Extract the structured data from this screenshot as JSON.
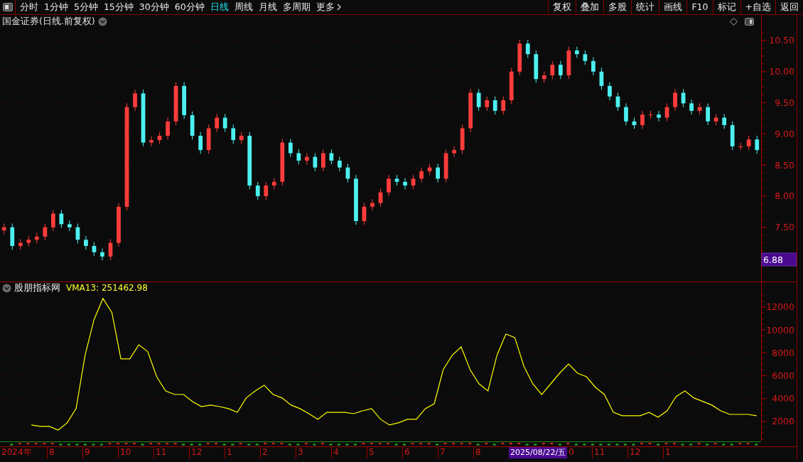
{
  "toolbar": {
    "periods": [
      {
        "label": "分时",
        "selected": false
      },
      {
        "label": "1分钟",
        "selected": false
      },
      {
        "label": "5分钟",
        "selected": false
      },
      {
        "label": "15分钟",
        "selected": false
      },
      {
        "label": "30分钟",
        "selected": false
      },
      {
        "label": "60分钟",
        "selected": false
      },
      {
        "label": "日线",
        "selected": true
      },
      {
        "label": "周线",
        "selected": false
      },
      {
        "label": "月线",
        "selected": false
      },
      {
        "label": "多周期",
        "selected": false
      },
      {
        "label": "更多",
        "selected": false
      }
    ],
    "actions": [
      "复权",
      "叠加",
      "多股",
      "统计",
      "画线",
      "F10",
      "标记",
      "+自选",
      "返回"
    ]
  },
  "price_panel": {
    "title": "国金证券(日线.前复权)",
    "chart_data": {
      "type": "candlestick",
      "ylim": [
        6.63,
        10.91
      ],
      "grid": true,
      "yticks": [
        {
          "value": 7.5,
          "label": "7.50"
        },
        {
          "value": 8,
          "label": "8.00"
        },
        {
          "value": 8.5,
          "label": "8.50"
        },
        {
          "value": 9,
          "label": "9.00"
        },
        {
          "value": 9.5,
          "label": "9.50"
        },
        {
          "value": 10,
          "label": "10.00"
        },
        {
          "value": 10.5,
          "label": "10.50"
        }
      ],
      "ohlc": [
        [
          7.45,
          7.56,
          7.39,
          7.5
        ],
        [
          7.5,
          7.56,
          7.14,
          7.2
        ],
        [
          7.2,
          7.31,
          7.14,
          7.25
        ],
        [
          7.25,
          7.36,
          7.19,
          7.3
        ],
        [
          7.3,
          7.41,
          7.24,
          7.35
        ],
        [
          7.35,
          7.56,
          7.29,
          7.5
        ],
        [
          7.5,
          7.78,
          7.44,
          7.72
        ],
        [
          7.72,
          7.78,
          7.49,
          7.55
        ],
        [
          7.55,
          7.61,
          7.44,
          7.5
        ],
        [
          7.5,
          7.56,
          7.24,
          7.3
        ],
        [
          7.3,
          7.36,
          7.14,
          7.2
        ],
        [
          7.2,
          7.26,
          7.04,
          7.1
        ],
        [
          7.1,
          7.16,
          6.97,
          7.03
        ],
        [
          7.03,
          7.31,
          6.97,
          7.25
        ],
        [
          7.25,
          7.89,
          7.19,
          7.83
        ],
        [
          7.83,
          9.49,
          7.77,
          9.43
        ],
        [
          9.43,
          9.71,
          9.37,
          9.65
        ],
        [
          9.65,
          9.71,
          8.8,
          8.86
        ],
        [
          8.86,
          8.96,
          8.8,
          8.9
        ],
        [
          8.9,
          9.03,
          8.84,
          8.97
        ],
        [
          8.97,
          9.26,
          8.91,
          9.2
        ],
        [
          9.2,
          9.83,
          9.14,
          9.77
        ],
        [
          9.77,
          9.83,
          9.24,
          9.3
        ],
        [
          9.3,
          9.36,
          8.91,
          8.97
        ],
        [
          8.97,
          9.03,
          8.68,
          8.74
        ],
        [
          8.74,
          9.15,
          8.68,
          9.09
        ],
        [
          9.09,
          9.32,
          9.03,
          9.26
        ],
        [
          9.26,
          9.32,
          9.03,
          9.09
        ],
        [
          9.09,
          9.15,
          8.84,
          8.9
        ],
        [
          8.9,
          9.03,
          8.84,
          8.97
        ],
        [
          8.97,
          9.03,
          8.11,
          8.17
        ],
        [
          8.17,
          8.23,
          7.94,
          8.0
        ],
        [
          8.0,
          8.23,
          7.94,
          8.17
        ],
        [
          8.17,
          8.29,
          8.11,
          8.23
        ],
        [
          8.23,
          8.92,
          8.17,
          8.86
        ],
        [
          8.86,
          8.92,
          8.63,
          8.69
        ],
        [
          8.69,
          8.75,
          8.51,
          8.57
        ],
        [
          8.57,
          8.69,
          8.51,
          8.63
        ],
        [
          8.63,
          8.69,
          8.4,
          8.46
        ],
        [
          8.46,
          8.75,
          8.4,
          8.69
        ],
        [
          8.69,
          8.75,
          8.51,
          8.57
        ],
        [
          8.57,
          8.63,
          8.4,
          8.46
        ],
        [
          8.46,
          8.52,
          8.22,
          8.28
        ],
        [
          8.28,
          8.34,
          7.54,
          7.6
        ],
        [
          7.6,
          7.89,
          7.54,
          7.83
        ],
        [
          7.83,
          7.95,
          7.77,
          7.89
        ],
        [
          7.89,
          8.12,
          7.83,
          8.06
        ],
        [
          8.06,
          8.34,
          8.0,
          8.28
        ],
        [
          8.28,
          8.34,
          8.17,
          8.23
        ],
        [
          8.23,
          8.29,
          8.11,
          8.17
        ],
        [
          8.17,
          8.34,
          8.11,
          8.28
        ],
        [
          8.28,
          8.46,
          8.22,
          8.4
        ],
        [
          8.4,
          8.52,
          8.34,
          8.46
        ],
        [
          8.46,
          8.52,
          8.22,
          8.28
        ],
        [
          8.28,
          8.75,
          8.22,
          8.69
        ],
        [
          8.69,
          8.8,
          8.63,
          8.74
        ],
        [
          8.74,
          9.15,
          8.68,
          9.09
        ],
        [
          9.09,
          9.72,
          9.03,
          9.66
        ],
        [
          9.66,
          9.72,
          9.37,
          9.43
        ],
        [
          9.43,
          9.6,
          9.37,
          9.54
        ],
        [
          9.54,
          9.6,
          9.31,
          9.37
        ],
        [
          9.37,
          9.6,
          9.31,
          9.54
        ],
        [
          9.54,
          10.06,
          9.48,
          10.0
        ],
        [
          10.0,
          10.51,
          9.94,
          10.45
        ],
        [
          10.45,
          10.51,
          10.22,
          10.28
        ],
        [
          10.28,
          10.34,
          9.82,
          9.88
        ],
        [
          9.88,
          10.0,
          9.82,
          9.94
        ],
        [
          9.94,
          10.17,
          9.88,
          10.11
        ],
        [
          10.11,
          10.17,
          9.88,
          9.94
        ],
        [
          9.94,
          10.4,
          9.88,
          10.34
        ],
        [
          10.34,
          10.4,
          10.22,
          10.28
        ],
        [
          10.28,
          10.34,
          10.11,
          10.17
        ],
        [
          10.17,
          10.23,
          9.94,
          10.0
        ],
        [
          10.0,
          10.06,
          9.71,
          9.77
        ],
        [
          9.77,
          9.83,
          9.54,
          9.6
        ],
        [
          9.6,
          9.66,
          9.37,
          9.43
        ],
        [
          9.43,
          9.49,
          9.14,
          9.2
        ],
        [
          9.2,
          9.26,
          9.08,
          9.14
        ],
        [
          9.14,
          9.37,
          9.08,
          9.31
        ],
        [
          9.31,
          9.37,
          9.25,
          9.31
        ],
        [
          9.31,
          9.37,
          9.2,
          9.26
        ],
        [
          9.26,
          9.49,
          9.2,
          9.43
        ],
        [
          9.43,
          9.72,
          9.37,
          9.66
        ],
        [
          9.66,
          9.72,
          9.43,
          9.49
        ],
        [
          9.49,
          9.55,
          9.31,
          9.37
        ],
        [
          9.37,
          9.49,
          9.31,
          9.43
        ],
        [
          9.43,
          9.49,
          9.14,
          9.2
        ],
        [
          9.2,
          9.32,
          9.14,
          9.26
        ],
        [
          9.26,
          9.32,
          9.08,
          9.14
        ],
        [
          9.14,
          9.2,
          8.74,
          8.8
        ],
        [
          8.8,
          8.86,
          8.74,
          8.8
        ],
        [
          8.8,
          8.97,
          8.74,
          8.91
        ],
        [
          8.91,
          8.97,
          8.68,
          8.74
        ]
      ],
      "annotations": [
        "6.88"
      ]
    }
  },
  "indicator_panel": {
    "source": "股朋指标网",
    "reading": "VMA13: 251462.98",
    "chart_data": {
      "type": "line",
      "ylim": [
        320,
        14170
      ],
      "grid": true,
      "yticks": [
        {
          "value": 2000,
          "label": "2000"
        },
        {
          "value": 4000,
          "label": "4000"
        },
        {
          "value": 6000,
          "label": "6000"
        },
        {
          "value": 8000,
          "label": "8000"
        },
        {
          "value": 10000,
          "label": "10000"
        },
        {
          "value": 12000,
          "label": "12000"
        }
      ],
      "series": [
        {
          "color": "#ffff00",
          "values": [
            null,
            null,
            null,
            1690,
            1570,
            1570,
            1250,
            1880,
            3120,
            7780,
            10900,
            12750,
            11500,
            7470,
            7470,
            8700,
            8090,
            5910,
            4670,
            4360,
            4360,
            3740,
            3300,
            3430,
            3300,
            3120,
            2800,
            4050,
            4670,
            5170,
            4360,
            4050,
            3430,
            3120,
            2680,
            2190,
            2800,
            2800,
            2800,
            2680,
            2930,
            3120,
            2190,
            1690,
            1880,
            2190,
            2190,
            3120,
            3550,
            6530,
            7780,
            8520,
            6530,
            5290,
            4670,
            7780,
            9640,
            9330,
            6840,
            5290,
            4360,
            5290,
            6220,
            7030,
            6220,
            5910,
            4980,
            4360,
            2800,
            2500,
            2500,
            2500,
            2800,
            2370,
            2930,
            4170,
            4670,
            4050,
            3740,
            3430,
            2930,
            2620,
            2620,
            2620,
            2500
          ]
        }
      ]
    }
  },
  "time_axis": [
    {
      "kind": "month",
      "label": "2024年"
    },
    {
      "kind": "month",
      "label": "8"
    },
    {
      "kind": "month",
      "label": "9"
    },
    {
      "kind": "month",
      "label": "10"
    },
    {
      "kind": "month",
      "label": "11"
    },
    {
      "kind": "month",
      "label": "12"
    },
    {
      "kind": "month",
      "label": "1"
    },
    {
      "kind": "month",
      "label": "2"
    },
    {
      "kind": "month",
      "label": "3"
    },
    {
      "kind": "month",
      "label": "4"
    },
    {
      "kind": "month",
      "label": "5"
    },
    {
      "kind": "month",
      "label": "6"
    },
    {
      "kind": "month",
      "label": "7"
    },
    {
      "kind": "month",
      "label": "8"
    },
    {
      "kind": "cursor",
      "label": "2025/08/22/五"
    },
    {
      "kind": "month",
      "label": "0"
    },
    {
      "kind": "month",
      "label": "11"
    },
    {
      "kind": "month",
      "label": "12"
    },
    {
      "kind": "month",
      "label": "1"
    }
  ]
}
